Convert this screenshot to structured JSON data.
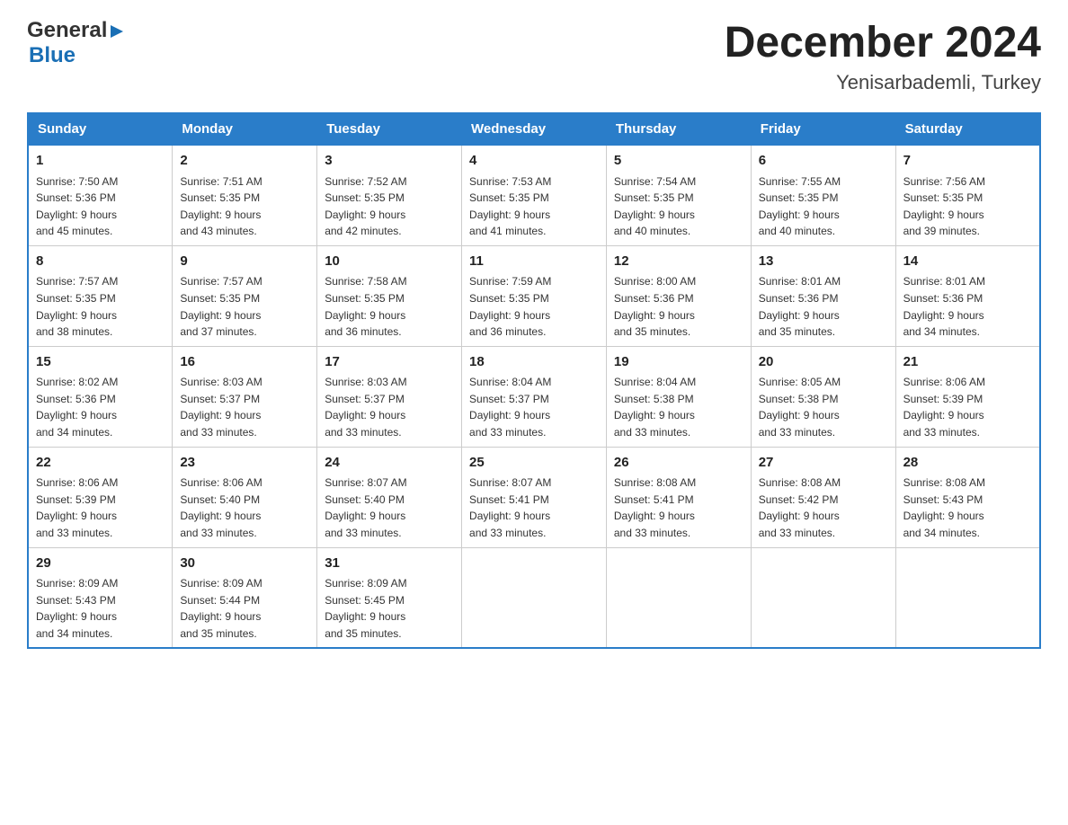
{
  "header": {
    "logo_general": "General",
    "logo_blue": "Blue",
    "month_title": "December 2024",
    "location": "Yenisarbademli, Turkey"
  },
  "weekdays": [
    "Sunday",
    "Monday",
    "Tuesday",
    "Wednesday",
    "Thursday",
    "Friday",
    "Saturday"
  ],
  "weeks": [
    [
      {
        "day": "1",
        "sunrise": "7:50 AM",
        "sunset": "5:36 PM",
        "daylight": "9 hours and 45 minutes."
      },
      {
        "day": "2",
        "sunrise": "7:51 AM",
        "sunset": "5:35 PM",
        "daylight": "9 hours and 43 minutes."
      },
      {
        "day": "3",
        "sunrise": "7:52 AM",
        "sunset": "5:35 PM",
        "daylight": "9 hours and 42 minutes."
      },
      {
        "day": "4",
        "sunrise": "7:53 AM",
        "sunset": "5:35 PM",
        "daylight": "9 hours and 41 minutes."
      },
      {
        "day": "5",
        "sunrise": "7:54 AM",
        "sunset": "5:35 PM",
        "daylight": "9 hours and 40 minutes."
      },
      {
        "day": "6",
        "sunrise": "7:55 AM",
        "sunset": "5:35 PM",
        "daylight": "9 hours and 40 minutes."
      },
      {
        "day": "7",
        "sunrise": "7:56 AM",
        "sunset": "5:35 PM",
        "daylight": "9 hours and 39 minutes."
      }
    ],
    [
      {
        "day": "8",
        "sunrise": "7:57 AM",
        "sunset": "5:35 PM",
        "daylight": "9 hours and 38 minutes."
      },
      {
        "day": "9",
        "sunrise": "7:57 AM",
        "sunset": "5:35 PM",
        "daylight": "9 hours and 37 minutes."
      },
      {
        "day": "10",
        "sunrise": "7:58 AM",
        "sunset": "5:35 PM",
        "daylight": "9 hours and 36 minutes."
      },
      {
        "day": "11",
        "sunrise": "7:59 AM",
        "sunset": "5:35 PM",
        "daylight": "9 hours and 36 minutes."
      },
      {
        "day": "12",
        "sunrise": "8:00 AM",
        "sunset": "5:36 PM",
        "daylight": "9 hours and 35 minutes."
      },
      {
        "day": "13",
        "sunrise": "8:01 AM",
        "sunset": "5:36 PM",
        "daylight": "9 hours and 35 minutes."
      },
      {
        "day": "14",
        "sunrise": "8:01 AM",
        "sunset": "5:36 PM",
        "daylight": "9 hours and 34 minutes."
      }
    ],
    [
      {
        "day": "15",
        "sunrise": "8:02 AM",
        "sunset": "5:36 PM",
        "daylight": "9 hours and 34 minutes."
      },
      {
        "day": "16",
        "sunrise": "8:03 AM",
        "sunset": "5:37 PM",
        "daylight": "9 hours and 33 minutes."
      },
      {
        "day": "17",
        "sunrise": "8:03 AM",
        "sunset": "5:37 PM",
        "daylight": "9 hours and 33 minutes."
      },
      {
        "day": "18",
        "sunrise": "8:04 AM",
        "sunset": "5:37 PM",
        "daylight": "9 hours and 33 minutes."
      },
      {
        "day": "19",
        "sunrise": "8:04 AM",
        "sunset": "5:38 PM",
        "daylight": "9 hours and 33 minutes."
      },
      {
        "day": "20",
        "sunrise": "8:05 AM",
        "sunset": "5:38 PM",
        "daylight": "9 hours and 33 minutes."
      },
      {
        "day": "21",
        "sunrise": "8:06 AM",
        "sunset": "5:39 PM",
        "daylight": "9 hours and 33 minutes."
      }
    ],
    [
      {
        "day": "22",
        "sunrise": "8:06 AM",
        "sunset": "5:39 PM",
        "daylight": "9 hours and 33 minutes."
      },
      {
        "day": "23",
        "sunrise": "8:06 AM",
        "sunset": "5:40 PM",
        "daylight": "9 hours and 33 minutes."
      },
      {
        "day": "24",
        "sunrise": "8:07 AM",
        "sunset": "5:40 PM",
        "daylight": "9 hours and 33 minutes."
      },
      {
        "day": "25",
        "sunrise": "8:07 AM",
        "sunset": "5:41 PM",
        "daylight": "9 hours and 33 minutes."
      },
      {
        "day": "26",
        "sunrise": "8:08 AM",
        "sunset": "5:41 PM",
        "daylight": "9 hours and 33 minutes."
      },
      {
        "day": "27",
        "sunrise": "8:08 AM",
        "sunset": "5:42 PM",
        "daylight": "9 hours and 33 minutes."
      },
      {
        "day": "28",
        "sunrise": "8:08 AM",
        "sunset": "5:43 PM",
        "daylight": "9 hours and 34 minutes."
      }
    ],
    [
      {
        "day": "29",
        "sunrise": "8:09 AM",
        "sunset": "5:43 PM",
        "daylight": "9 hours and 34 minutes."
      },
      {
        "day": "30",
        "sunrise": "8:09 AM",
        "sunset": "5:44 PM",
        "daylight": "9 hours and 35 minutes."
      },
      {
        "day": "31",
        "sunrise": "8:09 AM",
        "sunset": "5:45 PM",
        "daylight": "9 hours and 35 minutes."
      },
      null,
      null,
      null,
      null
    ]
  ],
  "labels": {
    "sunrise": "Sunrise:",
    "sunset": "Sunset:",
    "daylight": "Daylight:"
  }
}
